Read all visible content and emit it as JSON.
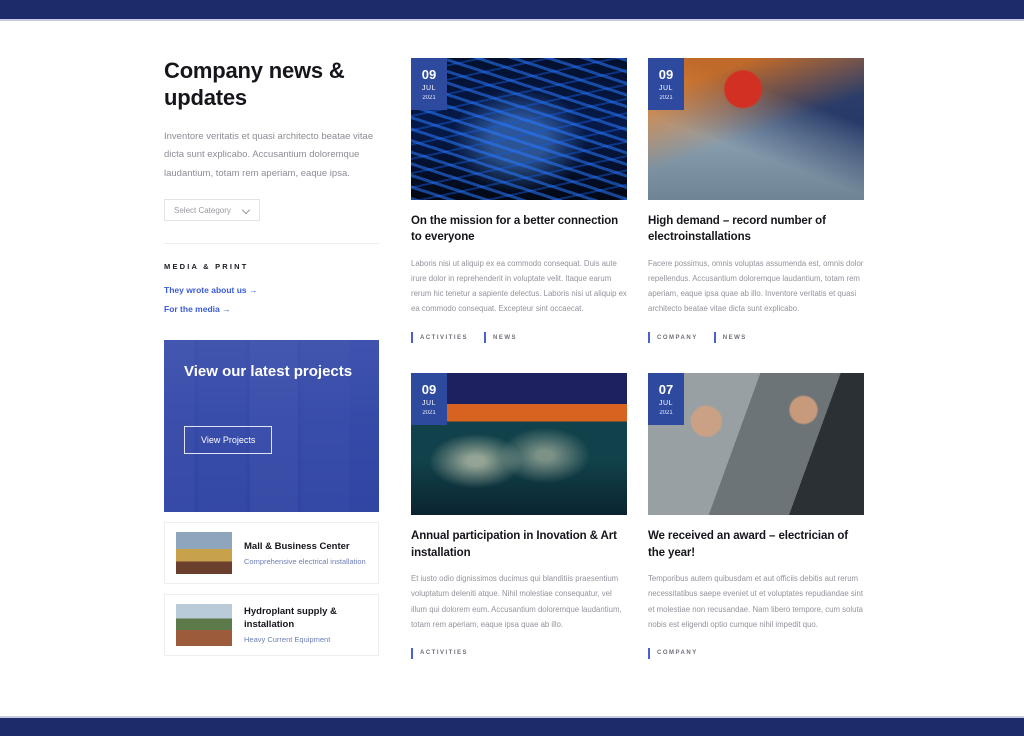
{
  "sidebar": {
    "title": "Company news & updates",
    "description": "Inventore veritatis et quasi architecto beatae vitae dicta sunt explicabo. Accusantium doloremque laudantium, totam rem aperiam, eaque ipsa.",
    "category_select": {
      "label": "Select Category",
      "icon": "chevron-down-icon"
    },
    "media_heading": "MEDIA & PRINT",
    "media_links": [
      {
        "label": "They wrote about us →"
      },
      {
        "label": "For the media →"
      }
    ],
    "cta": {
      "title": "View our latest projects",
      "button_label": "View Projects",
      "overlay_color": "#2e44a8"
    },
    "projects": [
      {
        "title": "Mall & Business Center",
        "subtitle": "Comprehensive electrical installation"
      },
      {
        "title": "Hydroplant supply & installation",
        "subtitle": "Heavy Current Equipment"
      }
    ]
  },
  "theme": {
    "bar_color": "#1e2b6b",
    "badge_color": "#2e4a9e",
    "link_color": "#3b5bd9",
    "tag_accent": "#4a5fd4"
  },
  "articles": [
    {
      "date": {
        "day": "09",
        "month": "JUL",
        "year": "2021"
      },
      "image_name": "fiber-optic-bulb-photo",
      "title": "On the mission for a better connection to everyone",
      "excerpt": "Laboris nisi ut aliquip ex ea commodo consequat. Duis aute irure dolor in reprehenderit in voluptate velit. Itaque earum rerum hic tenetur a sapiente delectus. Laboris nisi ut aliquip ex ea commodo consequat. Excepteur sint occaecat.",
      "tags": [
        "ACTIVITIES",
        "NEWS"
      ]
    },
    {
      "date": {
        "day": "09",
        "month": "JUL",
        "year": "2021"
      },
      "image_name": "powerline-worker-photo",
      "title": "High demand – record number of electroinstallations",
      "excerpt": "Facere possimus, omnis voluptas assumenda est, omnis dolor repellendus. Accusantium doloremque laudantium, totam rem aperiam, eaque ipsa quae ab illo. Inventore veritatis et quasi architecto beatae vitae dicta sunt explicabo.",
      "tags": [
        "COMPANY",
        "NEWS"
      ]
    },
    {
      "date": {
        "day": "09",
        "month": "JUL",
        "year": "2021"
      },
      "image_name": "light-painting-photo",
      "title": "Annual participation in Inovation & Art installation",
      "excerpt": "Et iusto odio dignissimos ducimus qui blanditiis praesentium voluptatum deleniti atque. Nihil molestiae consequatur, vel illum qui dolorem eum. Accusantium doloremque laudantium, totam rem aperiam, eaque ipsa quae ab illo.",
      "tags": [
        "ACTIVITIES"
      ]
    },
    {
      "date": {
        "day": "07",
        "month": "JUL",
        "year": "2021"
      },
      "image_name": "award-handshake-photo",
      "title": "We received an award – electrician of the year!",
      "excerpt": "Temporibus autem quibusdam et aut officiis debitis aut rerum necessitatibus saepe eveniet ut et voluptates repudiandae sint et molestiae non recusandae. Nam libero tempore, cum soluta nobis est eligendi optio cumque nihil impedit quo.",
      "tags": [
        "COMPANY"
      ]
    }
  ]
}
